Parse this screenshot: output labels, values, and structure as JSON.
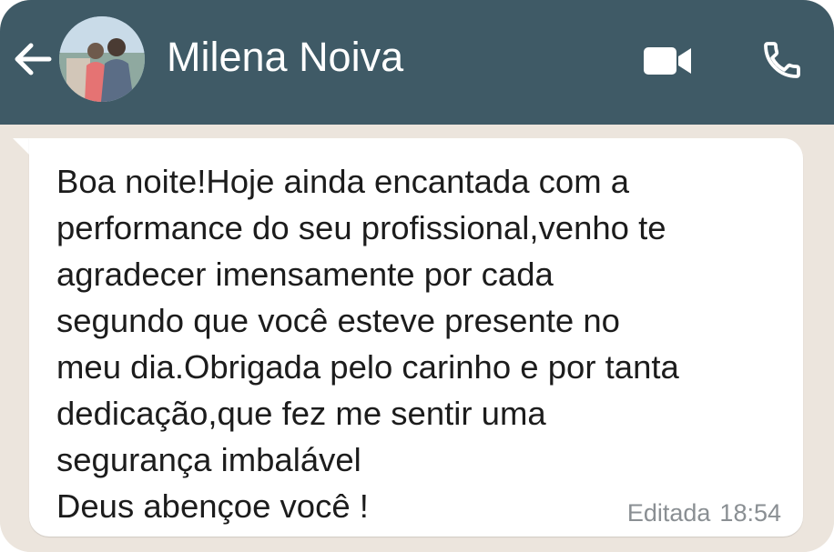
{
  "header": {
    "contact_name": "Milena Noiva",
    "back_icon": "arrow-left-icon",
    "video_icon": "video-camera-icon",
    "call_icon": "phone-icon",
    "background_color": "#3f5a66"
  },
  "chat": {
    "background_color": "#ece5dd",
    "messages": [
      {
        "text": "Boa noite!Hoje ainda encantada com a\nperformance do seu profissional,venho te\nagradecer imensamente por cada\nsegundo que você esteve presente no\nmeu dia.Obrigada pelo carinho e por tanta\ndedicação,que fez me sentir uma\nsegurança imbalável\nDeus abençoe você !",
        "edited_label": "Editada",
        "time": "18:54"
      }
    ]
  }
}
